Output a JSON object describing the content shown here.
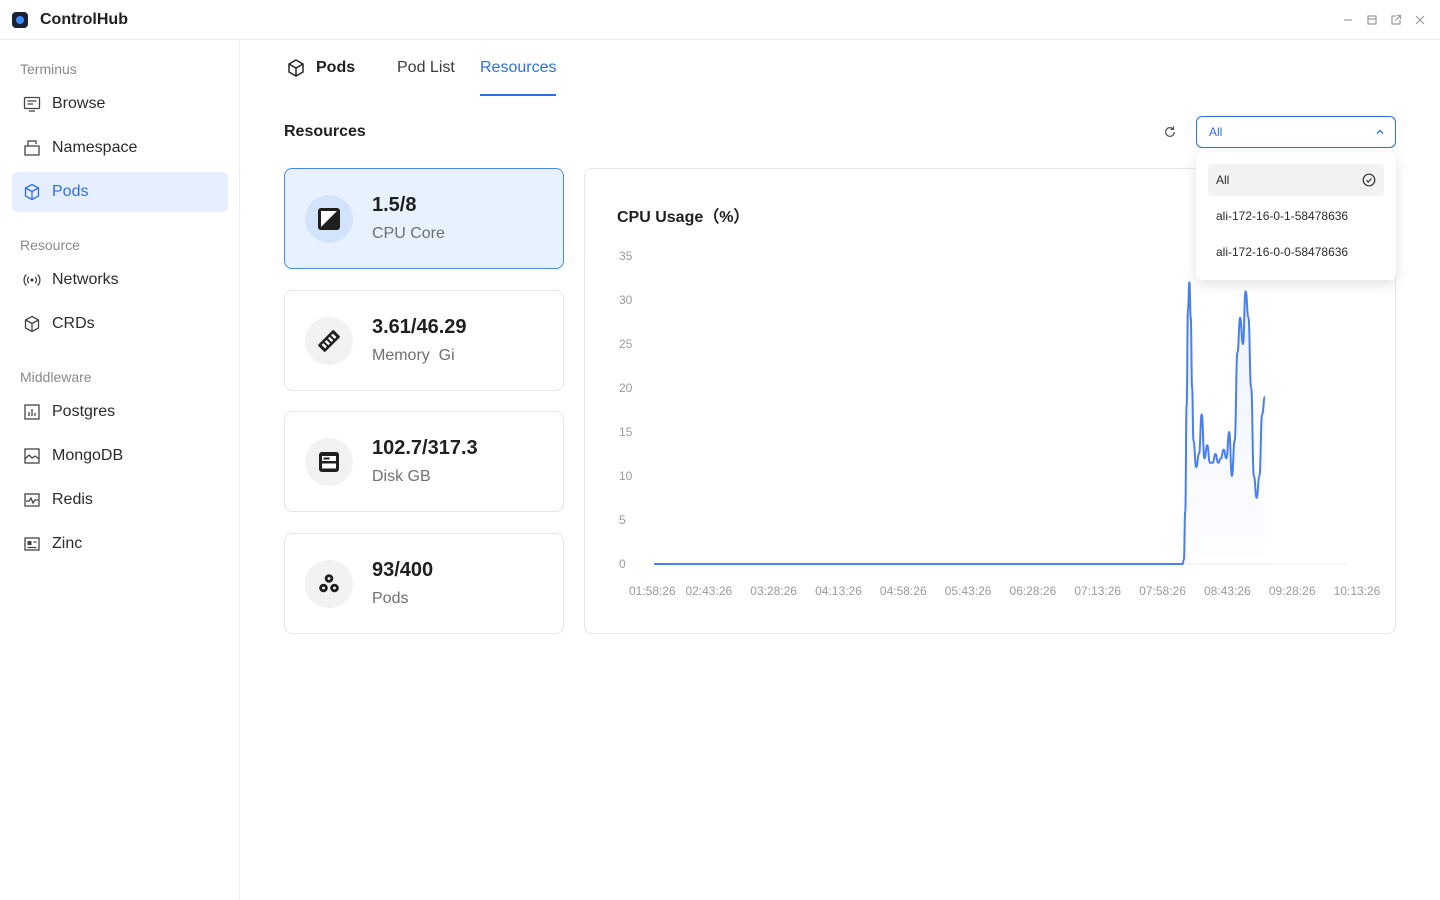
{
  "app": {
    "title": "ControlHub"
  },
  "sidebar": {
    "sections": [
      {
        "label": "Terminus",
        "items": [
          {
            "label": "Browse",
            "icon": "monitor-icon"
          },
          {
            "label": "Namespace",
            "icon": "folder-icon"
          },
          {
            "label": "Pods",
            "icon": "cube-icon",
            "active": true
          }
        ]
      },
      {
        "label": "Resource",
        "items": [
          {
            "label": "Networks",
            "icon": "wifi-icon"
          },
          {
            "label": "CRDs",
            "icon": "cube-icon"
          }
        ]
      },
      {
        "label": "Middleware",
        "items": [
          {
            "label": "Postgres",
            "icon": "bar-chart-icon"
          },
          {
            "label": "MongoDB",
            "icon": "image-stack-icon"
          },
          {
            "label": "Redis",
            "icon": "pulse-icon"
          },
          {
            "label": "Zinc",
            "icon": "id-card-icon"
          }
        ]
      }
    ]
  },
  "header": {
    "title": "Pods",
    "tabs": [
      {
        "label": "Pod List",
        "active": false
      },
      {
        "label": "Resources",
        "active": true
      }
    ]
  },
  "resources": {
    "title": "Resources",
    "select": {
      "value": "All",
      "options": [
        "All",
        "ali-172-16-0-1-58478636",
        "ali-172-16-0-0-58478636"
      ]
    },
    "cards": [
      {
        "value": "1.5/8",
        "label": "CPU Core",
        "icon": "cpu-icon",
        "active": true
      },
      {
        "value": "3.61/46.29",
        "label": "Memory  Gi",
        "icon": "memory-icon",
        "active": false
      },
      {
        "value": "102.7/317.3",
        "label": "Disk GB",
        "icon": "disk-icon",
        "active": false
      },
      {
        "value": "93/400",
        "label": "Pods",
        "icon": "pods-icon",
        "active": false
      }
    ]
  },
  "colors": {
    "accent": "#2f6fe4",
    "line": "#4a7ff0"
  },
  "chart_data": {
    "type": "line",
    "title": "CPU Usage（%）",
    "xlabel": "",
    "ylabel": "",
    "ylim": [
      0,
      35
    ],
    "yticks": [
      0,
      5,
      10,
      15,
      20,
      25,
      30,
      35
    ],
    "xticks": [
      "01:58:26",
      "02:43:26",
      "03:28:26",
      "04:13:26",
      "04:58:26",
      "05:43:26",
      "06:28:26",
      "07:13:26",
      "07:58:26",
      "08:43:26",
      "09:28:26",
      "10:13:26"
    ],
    "x_minutes_from_first_tick": [
      0,
      100,
      200,
      300,
      400,
      500,
      600,
      700,
      770,
      772,
      774,
      776,
      778,
      780,
      782,
      784,
      786,
      790,
      794,
      798,
      802,
      806,
      810,
      814,
      818,
      822,
      826,
      830,
      834,
      838,
      842,
      846,
      850,
      854,
      858,
      862,
      866,
      870,
      874,
      878,
      882,
      886,
      890
    ],
    "values": [
      0,
      0,
      0,
      0,
      0,
      0,
      0,
      0,
      0,
      0.5,
      6,
      18,
      29,
      32,
      28,
      20,
      14,
      11,
      12.5,
      17,
      12,
      13.5,
      11.5,
      11.5,
      12.5,
      11.5,
      12,
      13,
      12,
      15,
      10,
      14,
      24,
      28,
      25,
      31,
      28,
      20,
      10,
      7.5,
      10,
      17,
      19
    ]
  }
}
